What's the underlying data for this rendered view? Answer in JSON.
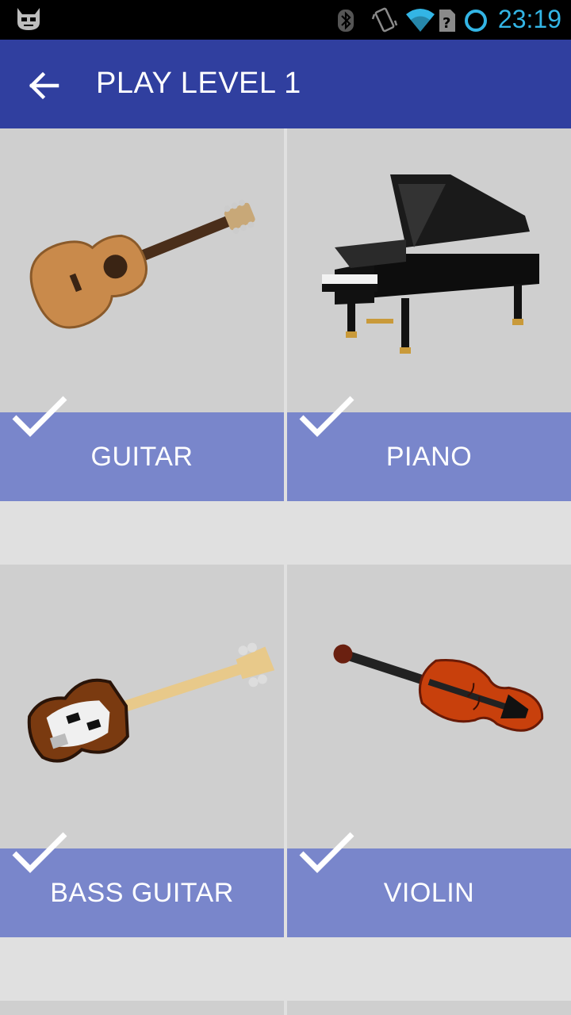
{
  "status_bar": {
    "time": "23:19",
    "icons": [
      "cyanogen-mod-icon",
      "bluetooth-icon",
      "vibrate-icon",
      "wifi-icon",
      "no-sim-icon",
      "sync-circle-icon"
    ]
  },
  "app_bar": {
    "back_icon": "arrow-back-icon",
    "title": "PLAY LEVEL 1"
  },
  "cards": [
    {
      "label": "GUITAR",
      "image": "acoustic-guitar",
      "checked": true
    },
    {
      "label": "PIANO",
      "image": "grand-piano",
      "checked": true
    },
    {
      "label": "BASS GUITAR",
      "image": "electric-bass-guitar",
      "checked": true
    },
    {
      "label": "VIOLIN",
      "image": "violin",
      "checked": true
    }
  ],
  "colors": {
    "status_bar": "#000000",
    "clock": "#33b5e5",
    "app_bar": "#303f9f",
    "label_bar": "#7986cb",
    "card_bg": "#cfcfcf",
    "page_bg": "#e0e0e0"
  }
}
